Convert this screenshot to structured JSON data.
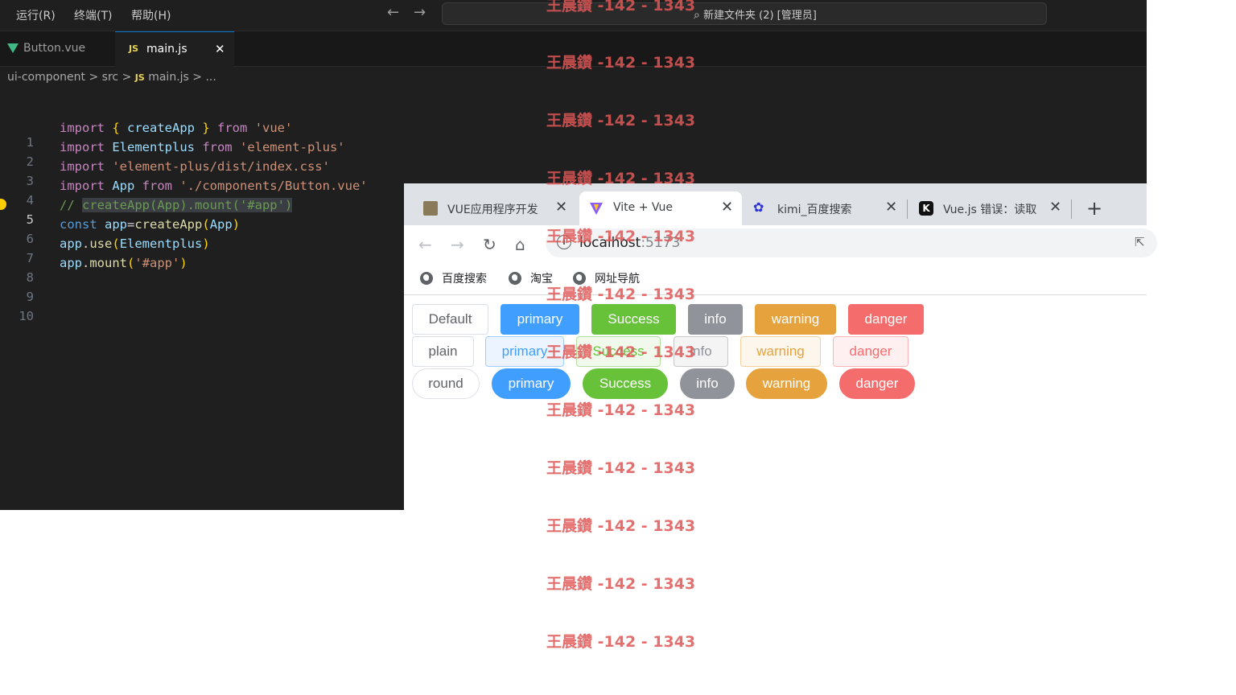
{
  "vscode": {
    "menu": [
      "运行(R)",
      "终端(T)",
      "帮助(H)"
    ],
    "command_center": "新建文件夹 (2) [管理员]",
    "tabs": [
      {
        "label": "Button.vue",
        "icon": "vue-icon"
      },
      {
        "label": "main.js",
        "icon": "js-icon",
        "close": "✕"
      }
    ],
    "js_badge": "JS",
    "breadcrumb": {
      "project": "ui-component",
      "folder": "src",
      "file": "main.js",
      "more": "..."
    },
    "line_numbers": [
      "1",
      "2",
      "3",
      "4",
      "5",
      "6",
      "7",
      "8",
      "9",
      "10"
    ],
    "active_line": "5",
    "code": {
      "l1": {
        "import": "import",
        "lb": "{",
        "name": " createApp ",
        "rb": "}",
        "from": " from ",
        "src": "'vue'"
      },
      "l2": {
        "import": "import",
        "name": " Elementplus",
        "from": " from ",
        "src": "'element-plus'"
      },
      "l3": {
        "import": "import",
        "src": " 'element-plus/dist/index.css'"
      },
      "l4": {
        "import": "import",
        "name": " App",
        "from": " from ",
        "src": "'./components/Button.vue'"
      },
      "l5": {
        "prefix": "// ",
        "body": "createApp(App).mount('#app')"
      },
      "l6": {
        "const": "const",
        "var": " app",
        "eq": "=",
        "fn": "createApp",
        "lp": "(",
        "arg": "App",
        "rp": ")"
      },
      "l7": {
        "obj": "app",
        "dot": ".",
        "fn": "use",
        "lp": "(",
        "arg": "Elementplus",
        "rp": ")"
      },
      "l8": {
        "obj": "app",
        "dot": ".",
        "fn": "mount",
        "lp": "(",
        "arg": "'#app'",
        "rp": ")"
      }
    }
  },
  "browser": {
    "tabs": [
      {
        "label": "VUE应用程序开发",
        "close": "✕"
      },
      {
        "label": "Vite + Vue",
        "close": "✕",
        "active": true
      },
      {
        "label": "kimi_百度搜索",
        "close": "✕"
      },
      {
        "label": "Vue.js 错误：读取",
        "close": "✕"
      }
    ],
    "new_tab": "+",
    "url_host": "localhost",
    "url_port": ":5173",
    "bookmarks": [
      "百度搜索",
      "淘宝",
      "网址导航"
    ]
  },
  "buttons": {
    "row1": [
      "Default",
      "primary",
      "Success",
      "info",
      "warning",
      "danger"
    ],
    "row2": [
      "plain",
      "primary",
      "Success",
      "info",
      "warning",
      "danger"
    ],
    "row3": [
      "round",
      "primary",
      "Success",
      "info",
      "warning",
      "danger"
    ]
  },
  "colors": {
    "primary": "#409eff",
    "success": "#67c23a",
    "info": "#909399",
    "warning": "#e6a23c",
    "danger": "#f56c6c",
    "editor_bg": "#1f1f1f"
  },
  "watermark": "王晨鑽 -142 - 1343"
}
